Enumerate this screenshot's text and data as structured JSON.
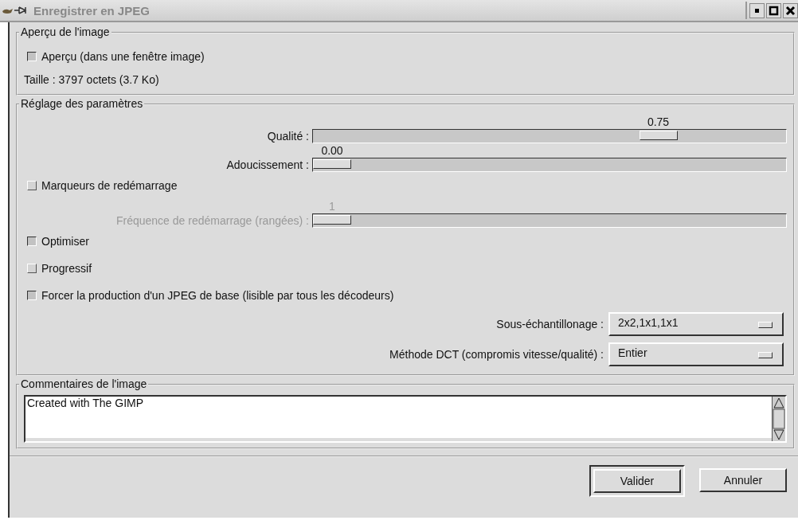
{
  "window": {
    "title": "Enregistrer en JPEG"
  },
  "preview": {
    "title": "Aperçu de l'image",
    "checkbox": {
      "label": "Aperçu (dans une fenêtre image)",
      "checked": true
    },
    "size": "Taille : 3797 octets (3.7 Ko)"
  },
  "settings": {
    "title": "Réglage des paramètres",
    "items": [
      {
        "kind": "slider",
        "label": "Qualité :",
        "reading": "0.75",
        "level": 0.75,
        "disabled": false
      },
      {
        "kind": "slider",
        "label": "Adoucissement :",
        "reading": "0.00",
        "level": 0,
        "disabled": false
      },
      {
        "kind": "checkbox",
        "label": "Marqueurs de redémarrage",
        "checked": false
      },
      {
        "kind": "slider",
        "label": "Fréquence de redémarrage (rangées) :",
        "reading": "1",
        "level": 0,
        "disabled": true
      },
      {
        "kind": "checkbox",
        "label": "Optimiser",
        "checked": true
      },
      {
        "kind": "checkbox",
        "label": "Progressif",
        "checked": false
      },
      {
        "kind": "checkbox",
        "label": "Forcer la production d'un JPEG de base (lisible par tous les décodeurs)",
        "checked": true
      },
      {
        "kind": "option",
        "label": "Sous-échantillonage :",
        "value": "2x2,1x1,1x1"
      },
      {
        "kind": "option",
        "label": "Méthode DCT (compromis vitesse/qualité) :",
        "value": "Entier"
      }
    ]
  },
  "comments": {
    "title": "Commentaires de l'image",
    "text": "Created with The GIMP"
  },
  "buttons": [
    {
      "label": "Valider",
      "default": true
    },
    {
      "label": "Annuler",
      "default": false
    }
  ]
}
